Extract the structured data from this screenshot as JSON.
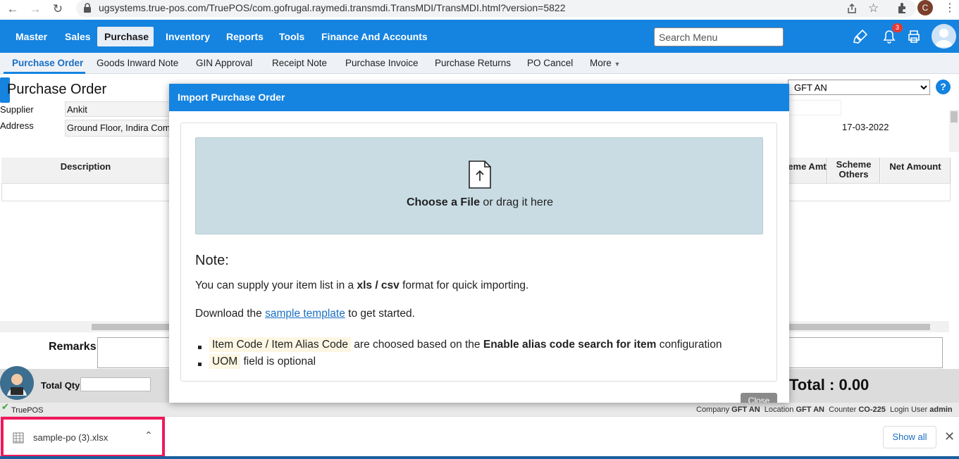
{
  "browser": {
    "url": "ugsystems.true-pos.com/TruePOS/com.gofrugal.raymedi.transmdi.TransMDI/TransMDI.html?version=5822",
    "profile_initial": "C"
  },
  "mainnav": {
    "items": [
      {
        "label": "Master"
      },
      {
        "label": "Sales"
      },
      {
        "label": "Purchase"
      },
      {
        "label": "Inventory"
      },
      {
        "label": "Reports"
      },
      {
        "label": "Tools"
      },
      {
        "label": "Finance And Accounts"
      }
    ],
    "active": "Purchase",
    "search_placeholder": "Search Menu",
    "notification_count": "3"
  },
  "subnav": {
    "items": [
      {
        "label": "Purchase Order"
      },
      {
        "label": "Goods Inward Note"
      },
      {
        "label": "GIN Approval"
      },
      {
        "label": "Receipt Note"
      },
      {
        "label": "Purchase Invoice"
      },
      {
        "label": "Purchase Returns"
      },
      {
        "label": "PO Cancel"
      },
      {
        "label": "More"
      }
    ],
    "active": "Purchase Order"
  },
  "form": {
    "title": "Purchase Order",
    "supplier_label": "Supplier",
    "supplier_value": "Ankit",
    "address_label": "Address",
    "address_value": "Ground Floor, Indira Comp",
    "location_value": "GFT AN",
    "date_value": "17-03-2022",
    "help": "?",
    "columns": {
      "description": "Description",
      "scheme_amt": "eme Amt",
      "scheme_others": "Scheme Others",
      "net_amount": "Net Amount"
    },
    "remarks_label": "Remarks",
    "total_qty_label": "Total Qty",
    "total_label": "Total : 0.00"
  },
  "statusbar": {
    "app_name": "TruePOS",
    "company_label": "Company",
    "company_value": "GFT AN",
    "location_label": "Location",
    "location_value": "GFT AN",
    "counter_label": "Counter",
    "counter_value": "CO-225",
    "login_label": "Login User",
    "login_value": "admin"
  },
  "modal": {
    "title": "Import Purchase Order",
    "drop_bold": "Choose a File",
    "drop_rest": " or drag it here",
    "note_heading": "Note:",
    "line1_pre": "You can supply your item list in a ",
    "line1_bold": "xls / csv",
    "line1_post": " format for quick importing.",
    "line2_pre": "Download the ",
    "line2_link": "sample template",
    "line2_post": " to get started.",
    "bullet1_hl": "Item Code / Item Alias Code",
    "bullet1_pre": " are choosed based on the ",
    "bullet1_bold": "Enable alias code search for item",
    "bullet1_post": " configuration",
    "bullet2_hl": "UOM",
    "bullet2_post": " field is optional",
    "close_label": "Close"
  },
  "download": {
    "filename": "sample-po (3).xlsx",
    "show_all": "Show all"
  }
}
